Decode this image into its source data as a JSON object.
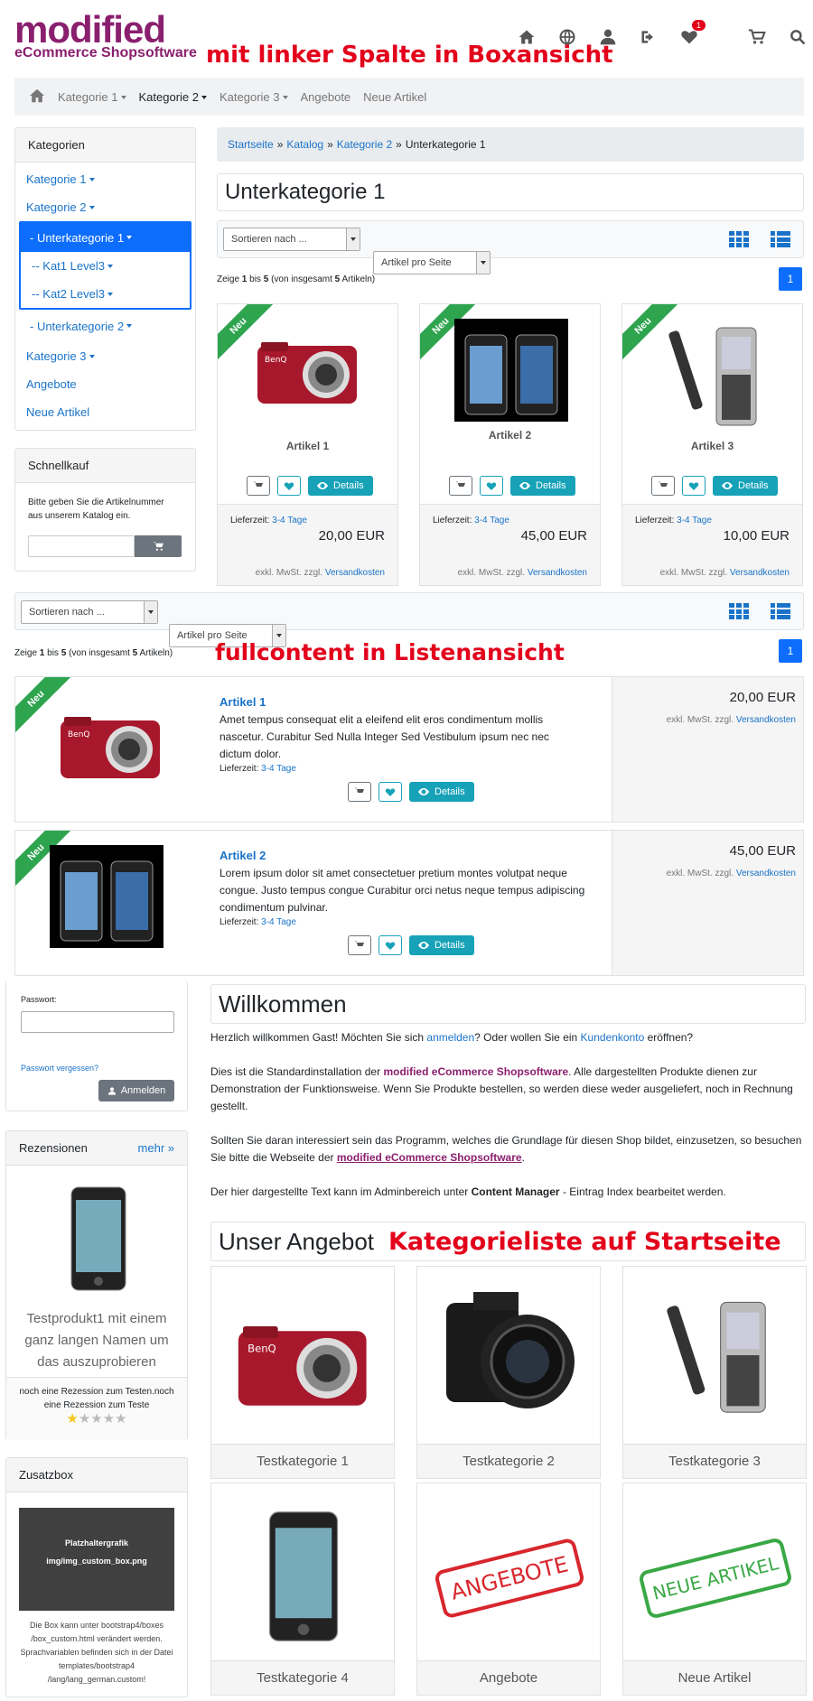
{
  "header": {
    "logo_main": "modified",
    "logo_sub": "eCommerce Shopsoftware",
    "annotation": "mit linker Spalte in Boxansicht",
    "icons": [
      "home-icon",
      "globe-icon",
      "user-icon",
      "logout-icon",
      "heart-icon",
      "cart-icon",
      "search-icon"
    ],
    "wishlist_count": "1"
  },
  "nav": {
    "items": [
      "Kategorie 1",
      "Kategorie 2",
      "Kategorie 3",
      "Angebote",
      "Neue Artikel"
    ]
  },
  "sidebar": {
    "categories_title": "Kategorien",
    "items": [
      "Kategorie 1",
      "Kategorie 2",
      "- Unterkategorie 1",
      "-- Kat1 Level3",
      "-- Kat2 Level3",
      "- Unterkategorie 2",
      "Kategorie 3",
      "Angebote",
      "Neue Artikel"
    ],
    "quick_title": "Schnellkauf",
    "quick_text": "Bitte geben Sie die Artikelnummer aus unserem Katalog ein."
  },
  "breadcrumb": {
    "items": [
      "Startseite",
      "Katalog",
      "Kategorie 2",
      "Unterkategorie 1"
    ],
    "sep": "»"
  },
  "page_title": "Unterkategorie 1",
  "listing": {
    "sort_placeholder": "Sortieren nach ...",
    "per_page_placeholder": "Artikel pro Seite",
    "count_prefix": "Zeige",
    "count_from": "1",
    "count_mid": "bis",
    "count_to": "5",
    "count_suffix": "(von insgesamt",
    "count_total": "5",
    "count_end": "Artikeln)",
    "page": "1",
    "badge": "Neu",
    "details_label": "Details",
    "delivery_label": "Lieferzeit:",
    "delivery_value": "3-4 Tage",
    "tax_text": "exkl. MwSt. zzgl.",
    "shipping_link": "Versandkosten"
  },
  "products": [
    {
      "name": "Artikel 1",
      "price": "20,00 EUR",
      "image": "camera-red"
    },
    {
      "name": "Artikel 2",
      "price": "45,00 EUR",
      "image": "iphone-pair"
    },
    {
      "name": "Artikel 3",
      "price": "10,00 EUR",
      "image": "nokia-phone"
    }
  ],
  "list_annotation": "fullcontent in Listenansicht",
  "list_products": [
    {
      "name": "Artikel 1",
      "price": "20,00 EUR",
      "desc": "Amet tempus consequat elit a eleifend elit eros condimentum mollis nascetur. Curabitur Sed Nulla Integer Sed Vestibulum ipsum nec nec dictum dolor."
    },
    {
      "name": "Artikel 2",
      "price": "45,00 EUR",
      "desc": "Lorem ipsum dolor sit amet consectetuer pretium montes volutpat neque congue. Justo tempus congue Curabitur orci netus neque tempus adipiscing condimentum pulvinar."
    }
  ],
  "login": {
    "password_label": "Passwort:",
    "forgot": "Passwort vergessen?",
    "button": "Anmelden"
  },
  "reviews": {
    "title": "Rezensionen",
    "more": "mehr »",
    "product": "Testprodukt1 mit einem ganz langen Namen um das auszuprobieren",
    "text": "noch eine Rezession zum Testen.noch eine Rezession zum Teste",
    "rating": 1,
    "rating_max": 5
  },
  "extra_box": {
    "title": "Zusatzbox",
    "placeholder_line1": "Platzhaltergrafik",
    "placeholder_line2": "img/img_custom_box.png",
    "text": "Die Box kann unter bootstrap4/boxes /box_custom.html verändert werden. Sprachvariablen befinden sich in der Datei templates/bootstrap4 /lang/lang_german.custom!"
  },
  "welcome": {
    "title": "Willkommen",
    "p1_a": "Herzlich willkommen Gast! Möchten Sie sich ",
    "p1_link1": "anmelden",
    "p1_b": "? Oder wollen Sie ein ",
    "p1_link2": "Kundenkonto",
    "p1_c": " eröffnen?",
    "p2_a": "Dies ist die Standardinstallation der ",
    "p2_brand": "modified eCommerce Shopsoftware",
    "p2_b": ". Alle dargestellten Produkte dienen zur Demonstration der Funktionsweise. Wenn Sie Produkte bestellen, so werden diese weder ausgeliefert, noch in Rechnung gestellt.",
    "p3_a": "Sollten Sie daran interessiert sein das Programm, welches die Grundlage für diesen Shop bildet, einzusetzen, so besuchen Sie bitte die Webseite der ",
    "p3_link": "modified eCommerce Shopsoftware",
    "p3_b": ".",
    "p4_a": "Der hier dargestellte Text kann im Adminbereich unter ",
    "p4_bold": "Content Manager",
    "p4_b": " - Eintrag Index bearbeitet werden."
  },
  "offer": {
    "title": "Unser Angebot",
    "annotation": "Kategorieliste auf Startseite",
    "tiles": [
      "Testkategorie 1",
      "Testkategorie 2",
      "Testkategorie 3",
      "Testkategorie 4",
      "Angebote",
      "Neue Artikel"
    ],
    "stamp_offers": "ANGEBOTE",
    "stamp_new": "NEUE ARTIKEL"
  },
  "colors": {
    "brand": "#8a1f6e",
    "primary": "#0d6efd",
    "info": "#17a2b8",
    "ribbon": "#2ea44f",
    "annotation": "#e3001b"
  }
}
